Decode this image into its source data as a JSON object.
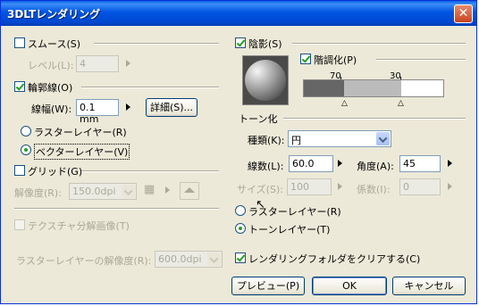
{
  "window": {
    "title": "3DLTレンダリング",
    "close": "✕"
  },
  "left": {
    "smooth": {
      "label": "スムース(S)",
      "checked": false
    },
    "level": {
      "label": "レベル(L):",
      "value": "4"
    },
    "outline": {
      "label": "輪郭線(O)",
      "checked": true
    },
    "line_width": {
      "label": "線幅(W):",
      "value": "0.1 mm"
    },
    "detail_button": "詳細(S)...",
    "raster_layer": "ラスターレイヤー(R)",
    "vector_layer": "ベクターレイヤー(V)",
    "grid": {
      "label": "グリッド(G)",
      "checked": false
    },
    "resolution": {
      "label": "解像度(R):",
      "value": "150.0dpi"
    },
    "texture": {
      "label": "テクスチャ分解画像(T)"
    },
    "raster_resolution": {
      "label": "ラスターレイヤーの解像度(R):",
      "value": "600.0dpi"
    }
  },
  "right": {
    "shadow": {
      "label": "陰影(S)",
      "checked": true
    },
    "gradation": {
      "label": "階調化(P)",
      "checked": true
    },
    "gradation_marks": {
      "left": "70",
      "right": "30",
      "left_pct": 70,
      "right_pct": 30
    },
    "tone_section": "トーン化",
    "kind": {
      "label": "種類(K):",
      "value": "円"
    },
    "lines": {
      "label": "線数(L):",
      "value": "60.0"
    },
    "angle": {
      "label": "角度(A):",
      "value": "45"
    },
    "size": {
      "label": "サイズ(S):",
      "value": "100"
    },
    "factor": {
      "label": "係数(I):",
      "value": "0"
    },
    "raster_layer": "ラスターレイヤー(R)",
    "tone_layer": "トーンレイヤー(T)",
    "clear_folder": {
      "label": "レンダリングフォルダをクリアする(C)",
      "checked": true
    }
  },
  "buttons": {
    "preview": "プレビュー(P)",
    "ok": "OK",
    "cancel": "キャンセル"
  }
}
